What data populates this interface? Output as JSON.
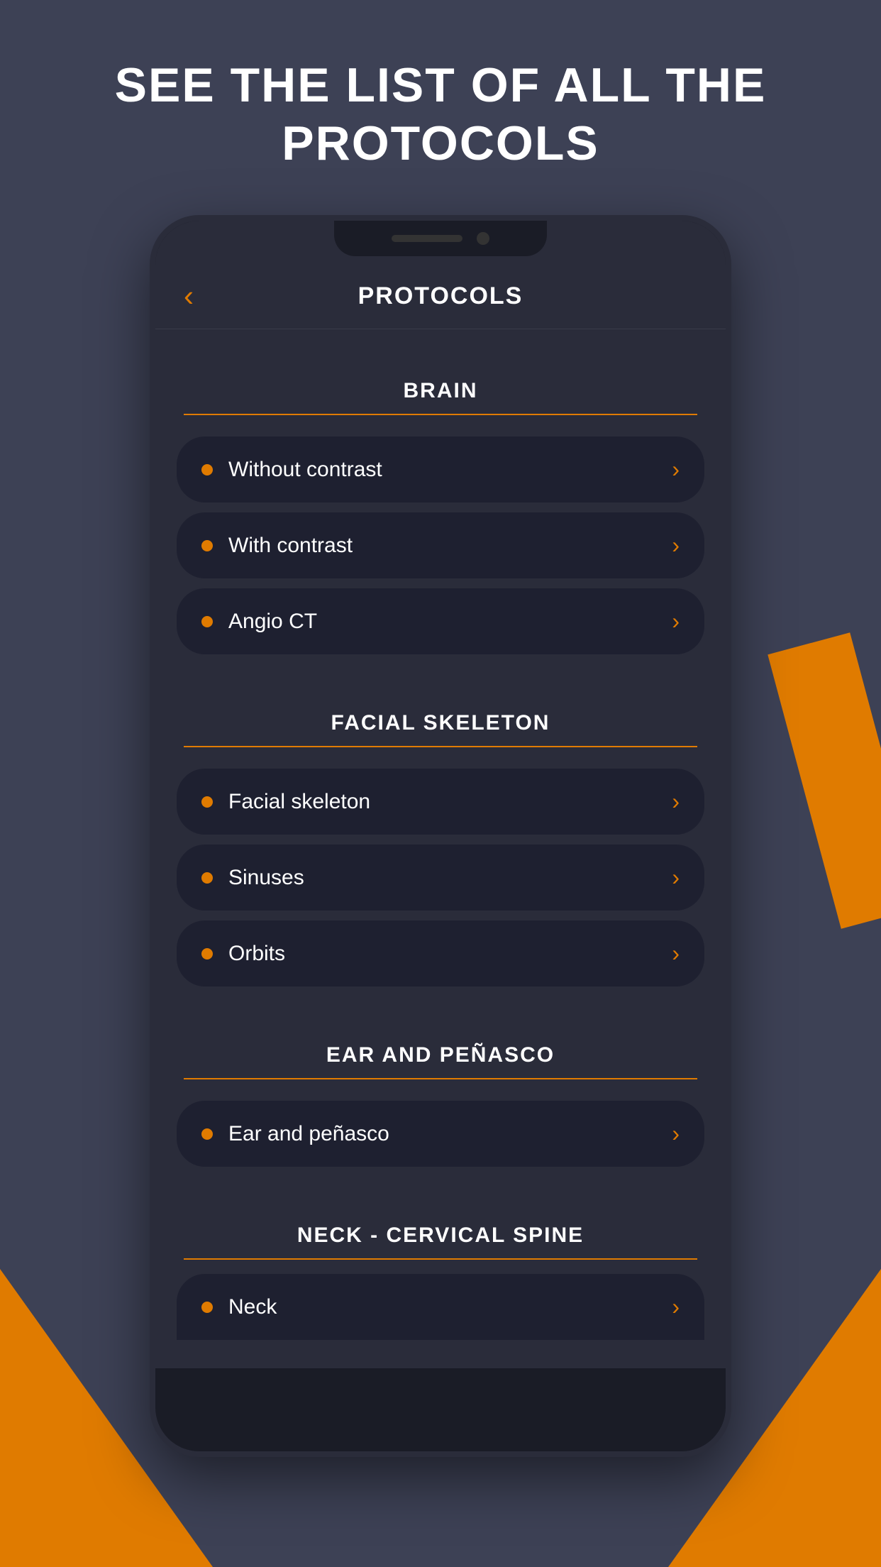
{
  "page": {
    "title": "SEE THE LIST OF ALL THE PROTOCOLS",
    "background_color": "#3d4155",
    "accent_color": "#e07b00"
  },
  "header": {
    "back_label": "‹",
    "title": "PROTOCOLS"
  },
  "sections": [
    {
      "id": "brain",
      "title": "BRAIN",
      "items": [
        {
          "label": "Without contrast"
        },
        {
          "label": "With contrast"
        },
        {
          "label": "Angio CT"
        }
      ]
    },
    {
      "id": "facial-skeleton",
      "title": "FACIAL SKELETON",
      "items": [
        {
          "label": "Facial skeleton"
        },
        {
          "label": "Sinuses"
        },
        {
          "label": "Orbits"
        }
      ]
    },
    {
      "id": "ear-penasco",
      "title": "EAR AND PEÑASCO",
      "items": [
        {
          "label": "Ear and peñasco"
        }
      ]
    },
    {
      "id": "neck-cervical",
      "title": "NECK - CERVICAL SPINE",
      "items": [
        {
          "label": "Neck"
        }
      ]
    }
  ],
  "icons": {
    "back": "‹",
    "chevron": "›",
    "dot": "●"
  }
}
